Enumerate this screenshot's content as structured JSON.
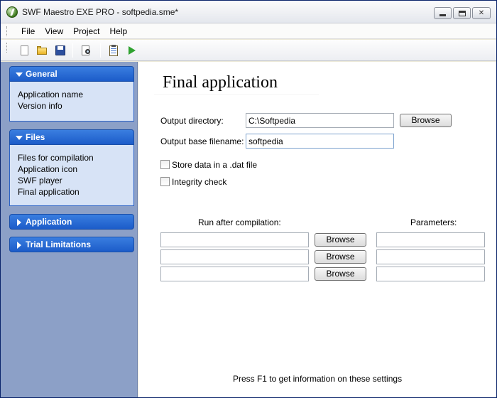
{
  "window": {
    "title": "SWF Maestro EXE PRO - softpedia.sme*"
  },
  "menu": [
    "File",
    "View",
    "Project",
    "Help"
  ],
  "toolbar": {
    "icons": [
      "new-icon",
      "open-folder-icon",
      "save-icon",
      "print-preview-icon",
      "properties-icon",
      "run-icon"
    ]
  },
  "sidebar": {
    "groups": [
      {
        "label": "General",
        "expanded": true,
        "items": [
          "Application name",
          "Version info"
        ]
      },
      {
        "label": "Files",
        "expanded": true,
        "items": [
          "Files for compilation",
          "Application icon",
          "SWF player",
          "Final application"
        ]
      },
      {
        "label": "Application",
        "expanded": false,
        "items": []
      },
      {
        "label": "Trial Limitations",
        "expanded": false,
        "items": []
      }
    ]
  },
  "main": {
    "title": "Final application",
    "output_directory": {
      "label": "Output directory:",
      "value": "C:\\Softpedia",
      "button": "Browse"
    },
    "output_base": {
      "label": "Output base filename:",
      "value": "softpedia"
    },
    "store_dat": {
      "label": "Store data in a .dat file",
      "checked": false
    },
    "integrity": {
      "label": "Integrity check",
      "checked": false
    },
    "run_after": {
      "header": "Run after compilation:",
      "params_header": "Parameters:",
      "rows": [
        {
          "path": "",
          "button": "Browse",
          "params": ""
        },
        {
          "path": "",
          "button": "Browse",
          "params": ""
        },
        {
          "path": "",
          "button": "Browse",
          "params": ""
        }
      ]
    },
    "hint": "Press F1 to get information on these settings"
  },
  "colors": {
    "sidebar_bg": "#8ca0c7",
    "group_header": "#1c5cc9",
    "group_body": "#d7e3f6"
  }
}
